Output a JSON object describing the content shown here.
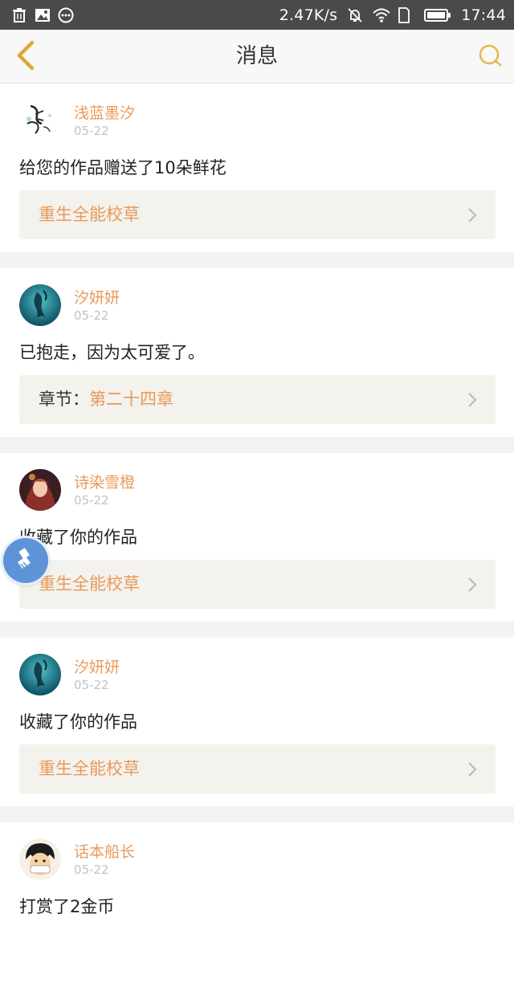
{
  "status_bar": {
    "network_speed": "2.47K/s",
    "time": "17:44",
    "left_icons": [
      "trash-icon",
      "image-icon",
      "more-circle-icon"
    ],
    "right_icons": [
      "mute-icon",
      "wifi-icon",
      "sim-icon",
      "battery-icon"
    ]
  },
  "nav": {
    "title": "消息",
    "back_icon": "chevron-left-icon",
    "search_icon": "search-icon",
    "accent_color": "#e9b84a"
  },
  "messages": [
    {
      "user": "浅蓝墨汐",
      "date": "05-22",
      "text": "给您的作品赠送了10朵鲜花",
      "ref_prefix": "",
      "ref_title": "重生全能校草"
    },
    {
      "user": "汐妍妍",
      "date": "05-22",
      "text": "已抱走，因为太可爱了。",
      "ref_prefix": "章节：",
      "ref_title": "第二十四章"
    },
    {
      "user": "诗染雪橙",
      "date": "05-22",
      "text": "收藏了你的作品",
      "ref_prefix": "",
      "ref_title": "重生全能校草"
    },
    {
      "user": "汐妍妍",
      "date": "05-22",
      "text": "收藏了你的作品",
      "ref_prefix": "",
      "ref_title": "重生全能校草"
    },
    {
      "user": "话本船长",
      "date": "05-22",
      "text": "打赏了2金币",
      "ref_prefix": "",
      "ref_title": ""
    }
  ],
  "colors": {
    "username": "#e9995a",
    "date": "#c2c2c2",
    "ref_background": "#f3f2ec",
    "page_background": "#f3f3f3",
    "floating_button": "#5f93d8"
  },
  "floating_button_icon": "broom-icon"
}
